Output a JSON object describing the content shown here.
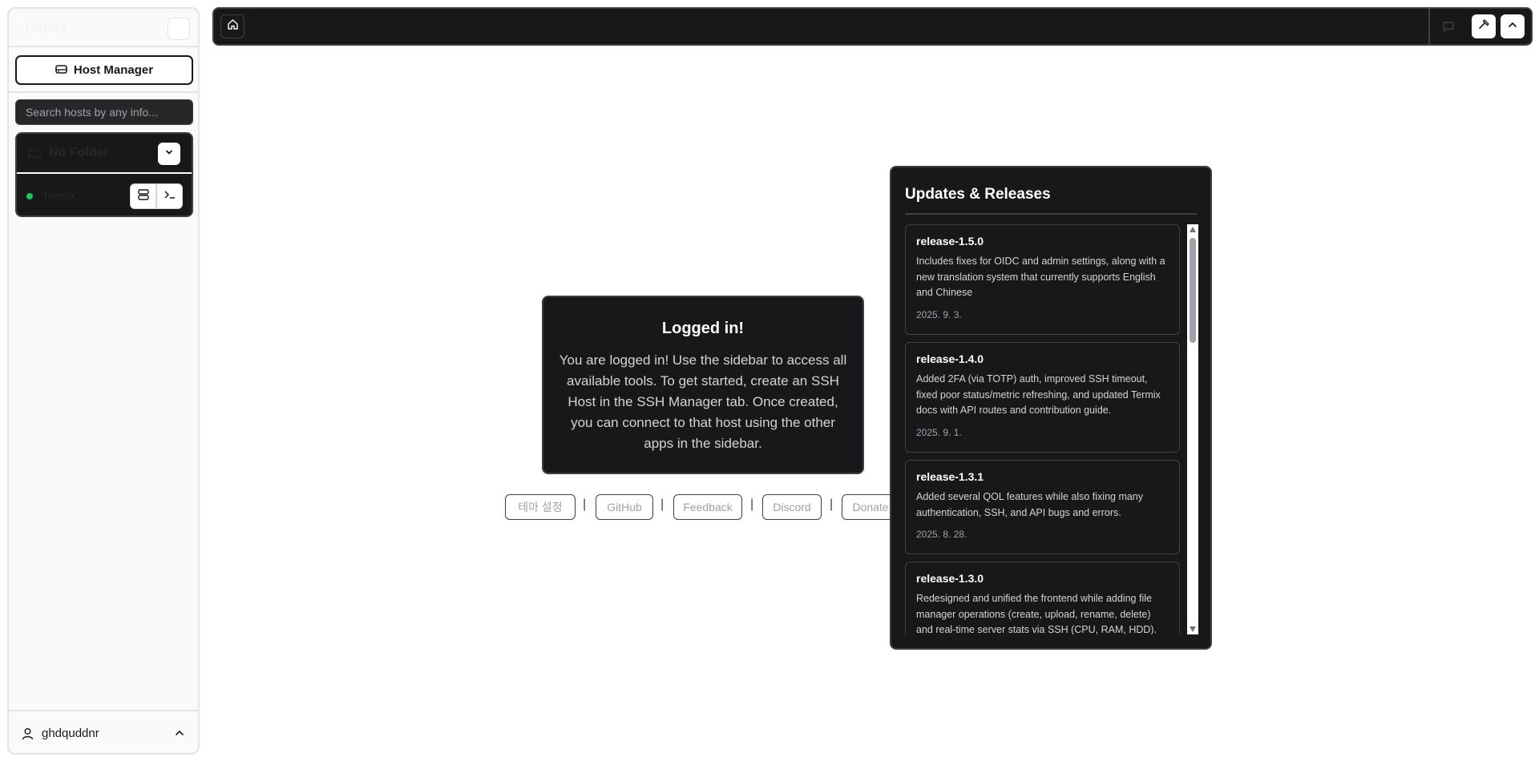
{
  "sidebar": {
    "app_title": "Termix",
    "host_manager_label": "Host Manager",
    "search_placeholder": "Search hosts by any info...",
    "folder_name": "No Folder",
    "host_name": "Termix",
    "host_status_color": "#22c55e",
    "username": "ghdquddnr"
  },
  "main": {
    "login_title": "Logged in!",
    "login_message": "You are logged in! Use the sidebar to access all available tools. To get started, create an SSH Host in the SSH Manager tab. Once created, you can connect to that host using the other apps in the sidebar.",
    "links": [
      "테마 설정",
      "GitHub",
      "Feedback",
      "Discord",
      "Donate"
    ],
    "link_separator": "|"
  },
  "updates": {
    "title": "Updates & Releases",
    "releases": [
      {
        "name": "release-1.5.0",
        "description": "Includes fixes for OIDC and admin settings, along with a new translation system that currently supports English and Chinese",
        "date": "2025. 9. 3."
      },
      {
        "name": "release-1.4.0",
        "description": "Added 2FA (via TOTP) auth, improved SSH timeout, fixed poor status/metric refreshing, and updated Termix docs with API routes and contribution guide.",
        "date": "2025. 9. 1."
      },
      {
        "name": "release-1.3.1",
        "description": "Added several QOL features while also fixing many authentication, SSH, and API bugs and errors.",
        "date": "2025. 8. 28."
      },
      {
        "name": "release-1.3.0",
        "description": "Redesigned and unified the frontend while adding file manager operations (create, upload, rename, delete) and real-time server stats via SSH (CPU, RAM, HDD).",
        "date": ""
      }
    ]
  },
  "icons": {
    "home": "home-icon",
    "hammer": "hammer-icon",
    "chevron_up": "chevron-up-icon",
    "chat": "message-square-icon",
    "server": "server-icon",
    "terminal": "terminal-icon",
    "user": "user-icon",
    "folder": "folder-icon",
    "hard_drive": "hard-drive-icon"
  }
}
